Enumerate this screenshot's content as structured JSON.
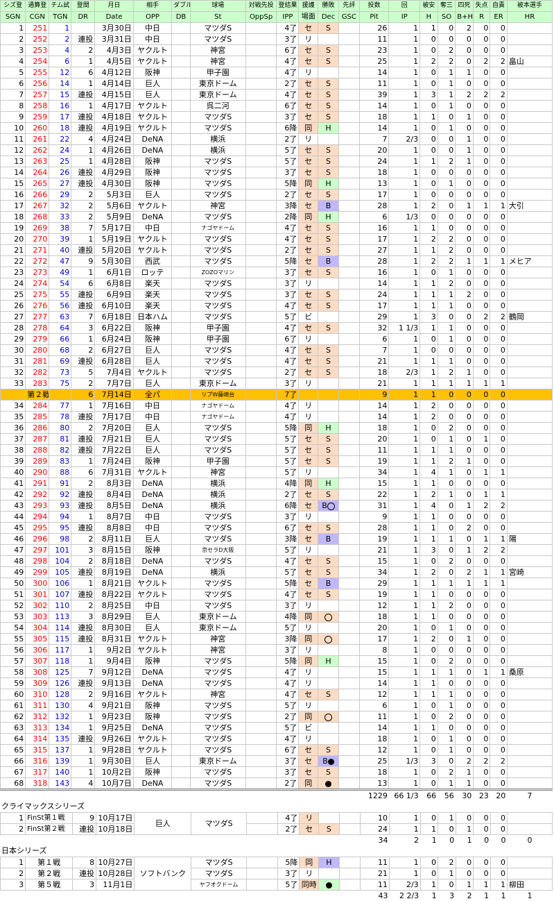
{
  "headers": {
    "row1": [
      "シズ登",
      "通算登",
      "チム試",
      "登間",
      "月日",
      "相手",
      "ダブル",
      "球場",
      "対戦先投",
      "登結果",
      "援護",
      "勝敗",
      "先評",
      "投数",
      "回",
      "被安",
      "奪三",
      "四死",
      "失点",
      "自責",
      "被本選手"
    ],
    "row2": [
      "SGN",
      "CGN",
      "TGN",
      "DR",
      "Date",
      "OPP",
      "DB",
      "St",
      "OppSp",
      "IPP",
      "場面",
      "Dec",
      "GSC",
      "Pit",
      "IP",
      "H",
      "SO",
      "B+H",
      "R",
      "ER",
      "HR"
    ]
  },
  "regular_season": [
    [
      "1",
      "251",
      "1",
      "",
      "3月30日",
      "中日",
      "",
      "マツダS",
      "",
      "4了",
      "セ",
      "S",
      "",
      "26",
      "1",
      "1",
      "0",
      "2",
      "0",
      "0",
      ""
    ],
    [
      "2",
      "252",
      "2",
      "連投",
      "3月31日",
      "中日",
      "",
      "マツダS",
      "",
      "3了",
      "リ",
      "",
      "",
      "11",
      "1",
      "0",
      "0",
      "0",
      "0",
      "0",
      ""
    ],
    [
      "3",
      "253",
      "4",
      "2",
      "4月3日",
      "ヤクルト",
      "",
      "神宮",
      "",
      "6了",
      "セ",
      "S",
      "",
      "23",
      "1",
      "0",
      "2",
      "0",
      "0",
      "0",
      ""
    ],
    [
      "4",
      "254",
      "6",
      "1",
      "4月5日",
      "ヤクルト",
      "",
      "神宮",
      "",
      "4了",
      "セ",
      "S",
      "",
      "25",
      "1",
      "2",
      "2",
      "0",
      "2",
      "2",
      "畠山"
    ],
    [
      "5",
      "255",
      "12",
      "6",
      "4月12日",
      "阪神",
      "",
      "甲子園",
      "",
      "4了",
      "リ",
      "",
      "",
      "14",
      "1",
      "0",
      "1",
      "1",
      "0",
      "0",
      ""
    ],
    [
      "6",
      "256",
      "14",
      "1",
      "4月14日",
      "巨人",
      "",
      "東京ドーム",
      "",
      "2了",
      "セ",
      "S",
      "",
      "11",
      "1",
      "0",
      "1",
      "0",
      "0",
      "0",
      ""
    ],
    [
      "7",
      "257",
      "15",
      "連投",
      "4月15日",
      "巨人",
      "",
      "東京ドーム",
      "",
      "4了",
      "セ",
      "S",
      "",
      "39",
      "1",
      "3",
      "1",
      "2",
      "2",
      "2",
      ""
    ],
    [
      "8",
      "258",
      "16",
      "1",
      "4月17日",
      "ヤクルト",
      "",
      "呉二河",
      "",
      "6了",
      "セ",
      "S",
      "",
      "14",
      "1",
      "0",
      "1",
      "0",
      "0",
      "0",
      ""
    ],
    [
      "9",
      "259",
      "17",
      "連投",
      "4月18日",
      "ヤクルト",
      "",
      "マツダS",
      "",
      "3了",
      "セ",
      "S",
      "",
      "18",
      "1",
      "1",
      "0",
      "1",
      "0",
      "0",
      ""
    ],
    [
      "10",
      "260",
      "18",
      "連投",
      "4月19日",
      "ヤクルト",
      "",
      "マツダS",
      "",
      "6降",
      "同",
      "H",
      "",
      "14",
      "1",
      "0",
      "1",
      "0",
      "0",
      "0",
      ""
    ],
    [
      "11",
      "261",
      "22",
      "4",
      "4月24日",
      "DeNA",
      "",
      "横浜",
      "",
      "2了",
      "リ",
      "",
      "",
      "7",
      "2/3",
      "0",
      "0",
      "1",
      "0",
      "0",
      ""
    ],
    [
      "12",
      "262",
      "24",
      "1",
      "4月26日",
      "DeNA",
      "",
      "横浜",
      "",
      "5了",
      "セ",
      "S",
      "",
      "20",
      "1",
      "0",
      "0",
      "1",
      "0",
      "0",
      ""
    ],
    [
      "13",
      "263",
      "25",
      "1",
      "4月28日",
      "阪神",
      "",
      "マツダS",
      "",
      "5了",
      "セ",
      "S",
      "",
      "24",
      "1",
      "1",
      "2",
      "1",
      "0",
      "0",
      ""
    ],
    [
      "14",
      "264",
      "26",
      "連投",
      "4月29日",
      "阪神",
      "",
      "マツダS",
      "",
      "3了",
      "セ",
      "S",
      "",
      "18",
      "1",
      "0",
      "0",
      "0",
      "0",
      "0",
      ""
    ],
    [
      "15",
      "265",
      "27",
      "連投",
      "4月30日",
      "阪神",
      "",
      "マツダS",
      "",
      "5降",
      "同",
      "H",
      "",
      "13",
      "1",
      "0",
      "1",
      "0",
      "0",
      "0",
      ""
    ],
    [
      "16",
      "266",
      "29",
      "2",
      "5月3日",
      "巨人",
      "",
      "マツダS",
      "",
      "2了",
      "セ",
      "S",
      "",
      "17",
      "1",
      "0",
      "0",
      "0",
      "0",
      "0",
      ""
    ],
    [
      "17",
      "267",
      "32",
      "2",
      "5月6日",
      "ヤクルト",
      "",
      "神宮",
      "",
      "3降",
      "セ",
      "B",
      "",
      "28",
      "1",
      "2",
      "0",
      "1",
      "1",
      "1",
      "大引"
    ],
    [
      "18",
      "268",
      "33",
      "2",
      "5月9日",
      "DeNA",
      "",
      "マツダS",
      "",
      "2降",
      "同",
      "H",
      "",
      "6",
      "1/3",
      "0",
      "0",
      "0",
      "0",
      "0",
      ""
    ],
    [
      "19",
      "269",
      "38",
      "7",
      "5月17日",
      "中日",
      "",
      "ナゴヤドーム",
      "",
      "4了",
      "セ",
      "S",
      "",
      "16",
      "1",
      "1",
      "0",
      "0",
      "0",
      "0",
      ""
    ],
    [
      "20",
      "270",
      "39",
      "1",
      "5月19日",
      "ヤクルト",
      "",
      "マツダS",
      "",
      "4了",
      "セ",
      "S",
      "",
      "17",
      "1",
      "2",
      "2",
      "0",
      "0",
      "0",
      ""
    ],
    [
      "21",
      "271",
      "40",
      "連投",
      "5月20日",
      "ヤクルト",
      "",
      "マツダS",
      "",
      "2了",
      "セ",
      "S",
      "",
      "27",
      "1",
      "1",
      "2",
      "0",
      "0",
      "0",
      ""
    ],
    [
      "22",
      "272",
      "47",
      "9",
      "5月30日",
      "西武",
      "",
      "マツダS",
      "",
      "5降",
      "セ",
      "B",
      "",
      "28",
      "1",
      "2",
      "2",
      "1",
      "1",
      "1",
      "メヒア"
    ],
    [
      "23",
      "273",
      "49",
      "1",
      "6月1日",
      "ロッテ",
      "",
      "ZOZOマリン",
      "",
      "3了",
      "セ",
      "S",
      "",
      "16",
      "1",
      "0",
      "1",
      "0",
      "0",
      "0",
      ""
    ],
    [
      "24",
      "274",
      "54",
      "6",
      "6月8日",
      "楽天",
      "",
      "マツダS",
      "",
      "3了",
      "リ",
      "",
      "",
      "14",
      "1",
      "1",
      "2",
      "0",
      "0",
      "0",
      ""
    ],
    [
      "25",
      "275",
      "55",
      "連投",
      "6月9日",
      "楽天",
      "",
      "マツダS",
      "",
      "3了",
      "セ",
      "S",
      "",
      "24",
      "1",
      "1",
      "1",
      "2",
      "0",
      "0",
      ""
    ],
    [
      "26",
      "276",
      "56",
      "連投",
      "6月10日",
      "楽天",
      "",
      "マツダS",
      "",
      "4了",
      "セ",
      "S",
      "",
      "17",
      "1",
      "1",
      "1",
      "0",
      "0",
      "0",
      ""
    ],
    [
      "27",
      "277",
      "63",
      "7",
      "6月18日",
      "日本ハム",
      "",
      "マツダS",
      "",
      "5了",
      "ビ",
      "",
      "",
      "29",
      "1",
      "3",
      "0",
      "0",
      "2",
      "2",
      "鶴岡"
    ],
    [
      "28",
      "278",
      "64",
      "3",
      "6月22日",
      "阪神",
      "",
      "甲子園",
      "",
      "4了",
      "セ",
      "S",
      "",
      "32",
      "1 1/3",
      "1",
      "1",
      "0",
      "0",
      "0",
      ""
    ],
    [
      "29",
      "279",
      "66",
      "1",
      "6月24日",
      "阪神",
      "",
      "甲子園",
      "",
      "6了",
      "リ",
      "",
      "",
      "6",
      "1",
      "0",
      "1",
      "0",
      "0",
      "0",
      ""
    ],
    [
      "30",
      "280",
      "68",
      "2",
      "6月27日",
      "巨人",
      "",
      "マツダS",
      "",
      "4了",
      "セ",
      "S",
      "",
      "7",
      "1",
      "0",
      "0",
      "0",
      "0",
      "0",
      ""
    ],
    [
      "31",
      "281",
      "69",
      "連投",
      "6月28日",
      "巨人",
      "",
      "マツダS",
      "",
      "4了",
      "セ",
      "S",
      "",
      "21",
      "1",
      "1",
      "1",
      "0",
      "0",
      "0",
      ""
    ],
    [
      "32",
      "282",
      "73",
      "5",
      "7月4日",
      "ヤクルト",
      "",
      "マツダS",
      "",
      "2了",
      "セ",
      "S",
      "",
      "18",
      "2/3",
      "1",
      "2",
      "1",
      "0",
      "0",
      ""
    ],
    [
      "33",
      "283",
      "75",
      "2",
      "7月7日",
      "巨人",
      "",
      "東京ドーム",
      "",
      "3了",
      "リ",
      "",
      "",
      "21",
      "1",
      "1",
      "1",
      "1",
      "1",
      "1",
      ""
    ]
  ],
  "allstar": [
    "",
    "第２戦",
    "",
    "6",
    "7月14日",
    "全パ",
    "",
    "リブW藤崎台",
    "",
    "7了",
    "",
    "",
    "",
    "9",
    "1",
    "1",
    "0",
    "0",
    "0",
    "0",
    ""
  ],
  "regular_season2": [
    [
      "34",
      "284",
      "77",
      "1",
      "7月16日",
      "中日",
      "",
      "ナゴヤドーム",
      "",
      "4了",
      "リ",
      "",
      "",
      "14",
      "1",
      "2",
      "0",
      "0",
      "0",
      "0",
      ""
    ],
    [
      "35",
      "285",
      "78",
      "連投",
      "7月17日",
      "中日",
      "",
      "ナゴヤドーム",
      "",
      "4了",
      "リ",
      "",
      "",
      "14",
      "1",
      "2",
      "0",
      "0",
      "0",
      "0",
      ""
    ],
    [
      "36",
      "286",
      "80",
      "2",
      "7月20日",
      "巨人",
      "",
      "マツダS",
      "",
      "5降",
      "同",
      "H",
      "",
      "18",
      "1",
      "0",
      "2",
      "0",
      "0",
      "0",
      ""
    ],
    [
      "37",
      "287",
      "81",
      "連投",
      "7月21日",
      "巨人",
      "",
      "マツダS",
      "",
      "5了",
      "セ",
      "S",
      "",
      "20",
      "1",
      "0",
      "1",
      "0",
      "1",
      "0",
      ""
    ],
    [
      "38",
      "288",
      "82",
      "連投",
      "7月22日",
      "巨人",
      "",
      "マツダS",
      "",
      "5了",
      "セ",
      "S",
      "",
      "11",
      "1",
      "1",
      "1",
      "0",
      "0",
      "0",
      ""
    ],
    [
      "39",
      "289",
      "83",
      "1",
      "7月24日",
      "阪神",
      "",
      "甲子園",
      "",
      "5了",
      "セ",
      "S",
      "",
      "19",
      "1",
      "1",
      "2",
      "1",
      "0",
      "0",
      ""
    ],
    [
      "40",
      "290",
      "88",
      "6",
      "7月31日",
      "ヤクルト",
      "",
      "神宮",
      "",
      "5了",
      "リ",
      "",
      "",
      "34",
      "1",
      "4",
      "1",
      "0",
      "1",
      "1",
      ""
    ],
    [
      "41",
      "291",
      "91",
      "2",
      "8月3日",
      "DeNA",
      "",
      "横浜",
      "",
      "4降",
      "同",
      "H",
      "",
      "15",
      "1",
      "1",
      "0",
      "0",
      "0",
      "0",
      ""
    ],
    [
      "42",
      "292",
      "92",
      "連投",
      "8月4日",
      "DeNA",
      "",
      "横浜",
      "",
      "2了",
      "セ",
      "S",
      "",
      "22",
      "1",
      "2",
      "1",
      "0",
      "1",
      "1",
      ""
    ],
    [
      "43",
      "293",
      "93",
      "連投",
      "8月5日",
      "DeNA",
      "",
      "横浜",
      "",
      "6降",
      "セ",
      "B○",
      "",
      "31",
      "1",
      "4",
      "0",
      "1",
      "2",
      "2",
      ""
    ],
    [
      "44",
      "294",
      "94",
      "1",
      "8月7日",
      "中日",
      "",
      "マツダS",
      "",
      "3了",
      "リ",
      "",
      "",
      "9",
      "1",
      "1",
      "0",
      "0",
      "0",
      "0",
      ""
    ],
    [
      "45",
      "295",
      "95",
      "連投",
      "8月8日",
      "中日",
      "",
      "マツダS",
      "",
      "6了",
      "セ",
      "S",
      "",
      "28",
      "1",
      "1",
      "0",
      "2",
      "0",
      "0",
      ""
    ],
    [
      "46",
      "296",
      "98",
      "2",
      "8月11日",
      "巨人",
      "",
      "マツダS",
      "",
      "3降",
      "セ",
      "B",
      "",
      "19",
      "1",
      "1",
      "1",
      "0",
      "1",
      "1",
      "陽"
    ],
    [
      "47",
      "297",
      "101",
      "3",
      "8月15日",
      "阪神",
      "",
      "京セラD大阪",
      "",
      "5了",
      "リ",
      "",
      "",
      "21",
      "1",
      "3",
      "0",
      "1",
      "2",
      "2",
      ""
    ],
    [
      "48",
      "298",
      "104",
      "2",
      "8月18日",
      "DeNA",
      "",
      "マツダS",
      "",
      "4了",
      "セ",
      "S",
      "",
      "15",
      "1",
      "0",
      "2",
      "0",
      "0",
      "0",
      ""
    ],
    [
      "49",
      "299",
      "105",
      "連投",
      "8月19日",
      "DeNA",
      "",
      "横浜",
      "",
      "5了",
      "セ",
      "S",
      "",
      "34",
      "1",
      "2",
      "0",
      "2",
      "1",
      "1",
      "宮崎"
    ],
    [
      "50",
      "300",
      "106",
      "1",
      "8月21日",
      "ヤクルト",
      "",
      "マツダS",
      "",
      "5降",
      "セ",
      "B",
      "",
      "29",
      "1",
      "1",
      "1",
      "1",
      "1",
      "1",
      ""
    ],
    [
      "51",
      "301",
      "107",
      "連投",
      "8月22日",
      "ヤクルト",
      "",
      "マツダS",
      "",
      "4了",
      "セ",
      "S",
      "",
      "19",
      "1",
      "1",
      "0",
      "0",
      "0",
      "0",
      ""
    ],
    [
      "52",
      "302",
      "110",
      "2",
      "8月25日",
      "中日",
      "",
      "マツダS",
      "",
      "3了",
      "リ",
      "",
      "",
      "12",
      "1",
      "1",
      "2",
      "0",
      "0",
      "0",
      ""
    ],
    [
      "53",
      "303",
      "113",
      "3",
      "8月29日",
      "巨人",
      "",
      "東京ドーム",
      "",
      "4降",
      "同",
      "○",
      "",
      "18",
      "1",
      "1",
      "0",
      "0",
      "0",
      "0",
      ""
    ],
    [
      "54",
      "304",
      "114",
      "連投",
      "8月30日",
      "巨人",
      "",
      "東京ドーム",
      "",
      "5了",
      "リ",
      "",
      "",
      "20",
      "1",
      "0",
      "1",
      "0",
      "0",
      "0",
      ""
    ],
    [
      "55",
      "305",
      "115",
      "連投",
      "8月31日",
      "ヤクルト",
      "",
      "神宮",
      "",
      "3降",
      "同",
      "○",
      "",
      "17",
      "1",
      "2",
      "0",
      "1",
      "0",
      "0",
      ""
    ],
    [
      "56",
      "306",
      "117",
      "1",
      "9月2日",
      "ヤクルト",
      "",
      "神宮",
      "",
      "3了",
      "リ",
      "",
      "",
      "8",
      "1",
      "0",
      "0",
      "0",
      "0",
      "0",
      ""
    ],
    [
      "57",
      "307",
      "118",
      "1",
      "9月4日",
      "阪神",
      "",
      "マツダS",
      "",
      "5降",
      "同",
      "H",
      "",
      "15",
      "1",
      "0",
      "2",
      "0",
      "0",
      "0",
      ""
    ],
    [
      "58",
      "308",
      "125",
      "7",
      "9月12日",
      "DeNA",
      "",
      "マツダS",
      "",
      "4了",
      "リ",
      "",
      "",
      "15",
      "1",
      "1",
      "1",
      "0",
      "1",
      "1",
      "桑原"
    ],
    [
      "59",
      "309",
      "126",
      "連投",
      "9月13日",
      "DeNA",
      "",
      "マツダS",
      "",
      "4了",
      "リ",
      "",
      "",
      "14",
      "1",
      "1",
      "0",
      "0",
      "0",
      "0",
      ""
    ],
    [
      "60",
      "310",
      "128",
      "2",
      "9月16日",
      "ヤクルト",
      "",
      "神宮",
      "",
      "4了",
      "セ",
      "S",
      "",
      "12",
      "1",
      "1",
      "1",
      "0",
      "0",
      "0",
      ""
    ],
    [
      "61",
      "311",
      "130",
      "4",
      "9月21日",
      "阪神",
      "",
      "マツダS",
      "",
      "5了",
      "リ",
      "",
      "",
      "6",
      "1",
      "0",
      "1",
      "0",
      "0",
      "0",
      ""
    ],
    [
      "62",
      "312",
      "132",
      "1",
      "9月23日",
      "阪神",
      "",
      "マツダS",
      "",
      "2了",
      "同",
      "○",
      "",
      "11",
      "1",
      "0",
      "2",
      "0",
      "0",
      "0",
      ""
    ],
    [
      "63",
      "313",
      "134",
      "1",
      "9月25日",
      "DeNA",
      "",
      "マツダS",
      "",
      "5了",
      "ビ",
      "",
      "",
      "14",
      "1",
      "1",
      "0",
      "0",
      "0",
      "0",
      ""
    ],
    [
      "64",
      "314",
      "135",
      "連投",
      "9月26日",
      "ヤクルト",
      "",
      "マツダS",
      "",
      "4了",
      "リ",
      "",
      "",
      "18",
      "1",
      "0",
      "1",
      "0",
      "0",
      "0",
      ""
    ],
    [
      "65",
      "315",
      "137",
      "1",
      "9月28日",
      "ヤクルト",
      "",
      "マツダS",
      "",
      "6了",
      "セ",
      "S",
      "",
      "12",
      "1",
      "0",
      "1",
      "0",
      "0",
      "0",
      ""
    ],
    [
      "66",
      "316",
      "139",
      "1",
      "9月30日",
      "巨人",
      "",
      "東京ドーム",
      "",
      "3了",
      "セ",
      "B●",
      "",
      "25",
      "1/3",
      "3",
      "0",
      "2",
      "2",
      "2",
      ""
    ],
    [
      "67",
      "317",
      "140",
      "1",
      "10月2日",
      "阪神",
      "",
      "マツダS",
      "",
      "3了",
      "セ",
      "S",
      "",
      "18",
      "1",
      "0",
      "2",
      "1",
      "0",
      "0",
      ""
    ],
    [
      "68",
      "318",
      "143",
      "4",
      "10月7日",
      "DeNA",
      "",
      "マツダS",
      "",
      "2了",
      "同",
      "●",
      "",
      "13",
      "1",
      "0",
      "1",
      "1",
      "0",
      "0",
      ""
    ]
  ],
  "regular_totals": [
    "1229",
    "66 1/3",
    "66",
    "56",
    "30",
    "23",
    "20",
    "7"
  ],
  "climax": {
    "title": "クライマックスシリーズ",
    "opp": "巨人",
    "stadium": "マツダS",
    "rows": [
      [
        "1",
        "FinSt第１戦",
        "9",
        "10月17日",
        "4了",
        "リ",
        "",
        "10",
        "1",
        "0",
        "1",
        "0",
        "0",
        "0",
        ""
      ],
      [
        "2",
        "FinSt第２戦",
        "連投",
        "10月18日",
        "2了",
        "セ",
        "S",
        "24",
        "1",
        "1",
        "0",
        "1",
        "0",
        "0",
        ""
      ]
    ],
    "totals": [
      "34",
      "2",
      "1",
      "0",
      "1",
      "0",
      "0",
      "0"
    ]
  },
  "japan": {
    "title": "日本シリーズ",
    "opp": "ソフトバンク",
    "rows": [
      [
        "1",
        "第１戦",
        "8",
        "10月27日",
        "マツダS",
        "5降",
        "同",
        "H",
        "11",
        "1",
        "0",
        "2",
        "0",
        "0",
        "0",
        ""
      ],
      [
        "2",
        "第２戦",
        "連投",
        "10月28日",
        "マツダS",
        "3了",
        "リ",
        "",
        "21",
        "1",
        "0",
        "1",
        "0",
        "0",
        "0",
        ""
      ],
      [
        "3",
        "第５戦",
        "3",
        "11月1日",
        "ヤフオクドーム",
        "5了",
        "同時",
        "●",
        "11",
        "2/3",
        "1",
        "0",
        "1",
        "1",
        "1",
        "柳田"
      ]
    ],
    "totals": [
      "43",
      "2 2/3",
      "1",
      "3",
      "2",
      "1",
      "1",
      "1"
    ]
  }
}
